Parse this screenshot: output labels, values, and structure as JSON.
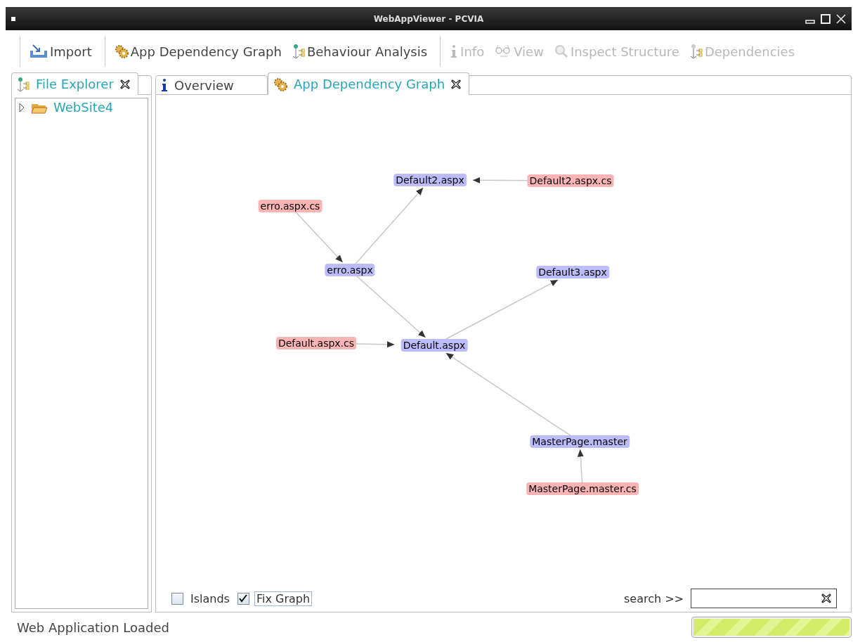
{
  "window": {
    "title": "WebAppViewer - PCVIA"
  },
  "toolbar": {
    "groups": [
      [
        {
          "label": "Import",
          "disabled": false
        }
      ],
      [
        {
          "label": "App Dependency Graph",
          "disabled": false
        },
        {
          "label": "Behaviour Analysis",
          "disabled": false
        }
      ],
      [
        {
          "label": "Info",
          "disabled": true
        },
        {
          "label": "View",
          "disabled": true
        },
        {
          "label": "Inspect Structure",
          "disabled": true
        },
        {
          "label": "Dependencies",
          "disabled": true
        }
      ]
    ]
  },
  "explorer": {
    "tabs": [
      {
        "label": "File Explorer",
        "selected": true
      }
    ],
    "tree": [
      {
        "label": "WebSite4",
        "expanded": false
      }
    ]
  },
  "editor": {
    "tabs": [
      {
        "label": "Overview",
        "selected": false
      },
      {
        "label": "App Dependency Graph",
        "selected": true
      }
    ],
    "graph": {
      "nodes": [
        {
          "label": "Default2.aspx",
          "color": "#bcbcfa"
        },
        {
          "label": "Default2.aspx.cs",
          "color": "#fbb4b4"
        },
        {
          "label": "erro.aspx.cs",
          "color": "#fbb4b4"
        },
        {
          "label": "erro.aspx",
          "color": "#bcbcfa"
        },
        {
          "label": "Default3.aspx",
          "color": "#bcbcfa"
        },
        {
          "label": "Default.aspx.cs",
          "color": "#fbb4b4"
        },
        {
          "label": "Default.aspx",
          "color": "#bcbcfa"
        },
        {
          "label": "MasterPage.master",
          "color": "#bcbcfa"
        },
        {
          "label": "MasterPage.master.cs",
          "color": "#fbb4b4"
        }
      ]
    },
    "options": [
      {
        "label": "Islands",
        "checked": false
      },
      {
        "label": "Fix Graph",
        "checked": true
      }
    ],
    "search": {
      "label": "search >>"
    }
  },
  "status_bar": {
    "text": "Web Application Loaded",
    "progress": {
      "level": 1
    }
  }
}
